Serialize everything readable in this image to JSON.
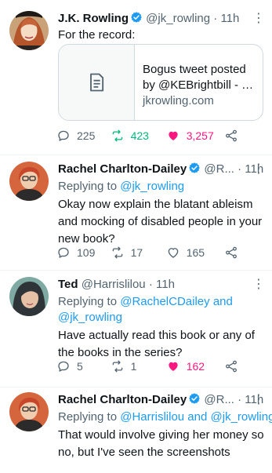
{
  "tweets": [
    {
      "name": "J.K. Rowling",
      "handle": "@jk_rowling",
      "sep": "·",
      "time": "11h",
      "text": "For the record:",
      "card": {
        "title_line1": "Bogus tweet posted",
        "title_line2": "by @KEBrightbill - J...",
        "domain": "jkrowling.com",
        "icon": "document-icon"
      },
      "replies": "225",
      "retweets": "423",
      "likes": "3,257",
      "liked": true,
      "retweeted": true
    },
    {
      "name": "Rachel Charlton-Dailey",
      "handle": "@R...",
      "sep": "·",
      "time": "11h",
      "replying_prefix": "Replying to ",
      "replying_to": "@jk_rowling",
      "text_lines": [
        "Okay now explain the blatant ableism",
        "and mocking of disabled people in your",
        "new book?"
      ],
      "replies": "109",
      "retweets": "17",
      "likes": "165",
      "liked": false
    },
    {
      "name": "Ted",
      "handle": "@Harrislilou",
      "sep": "·",
      "time": "11h",
      "replying_prefix": "Replying to ",
      "replying_to_1": "@RachelCDailey",
      "replying_and": " and",
      "replying_to_2": "@jk_rowling",
      "text_lines": [
        "Have actually read this book or any of",
        "the books in the series?"
      ],
      "replies": "5",
      "retweets": "1",
      "likes": "162",
      "liked": true
    },
    {
      "name": "Rachel Charlton-Dailey",
      "handle": "@R...",
      "sep": "·",
      "time": "11h",
      "replying_prefix": "Replying to ",
      "replying_to_1": "@Harrislilou",
      "replying_and": " and ",
      "replying_to_2": "@jk_rowling",
      "text_lines": [
        "That would involve giving her money so",
        "no, but I've seen the screenshots"
      ]
    }
  ],
  "colors": {
    "accent": "#1d9bf0",
    "like": "#f91880",
    "retweet": "#00ba7c",
    "muted": "#536471"
  }
}
